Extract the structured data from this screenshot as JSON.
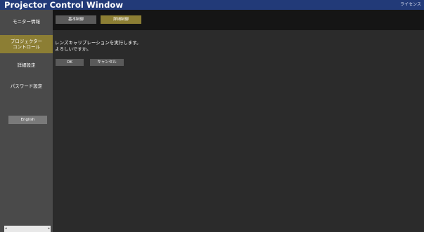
{
  "header": {
    "title": "Projector Control Window",
    "license_link": "ライセンス"
  },
  "sidebar": {
    "items": [
      {
        "label": "モニター情報"
      },
      {
        "label_line1": "プロジェクター",
        "label_line2": "コントロール"
      },
      {
        "label": "詳細設定"
      },
      {
        "label": "パスワード設定"
      }
    ],
    "language_button": "English"
  },
  "tabs": {
    "basic": "基本制御",
    "detail": "詳細制御"
  },
  "main": {
    "message_line1": "レンズキャリブレーションを実行します。",
    "message_line2": "よろしいですか。",
    "ok_label": "OK",
    "cancel_label": "キャンセル"
  },
  "colors": {
    "titlebar": "#223a78",
    "accent": "#8c7e34",
    "sidebar": "#4a4a4a",
    "background": "#2b2b2b"
  }
}
